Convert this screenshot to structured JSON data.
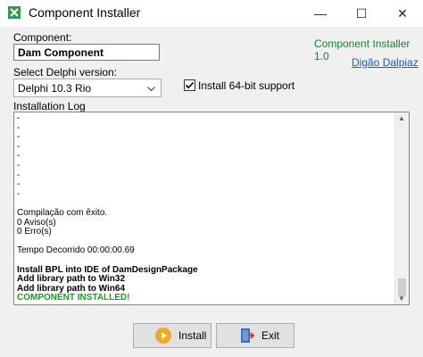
{
  "window": {
    "title": "Component Installer",
    "controls": {
      "minimize": "—",
      "maximize": "☐",
      "close": "✕"
    }
  },
  "header": {
    "component_label": "Component:",
    "component_value": "Dam Component",
    "version_text": "Component Installer 1.0",
    "author_link": "Digão Dalpiaz"
  },
  "delphi": {
    "label": "Select Delphi version:",
    "selected": "Delphi 10.3 Rio",
    "option_64bit_label": "Install 64-bit support",
    "option_64bit_checked": true
  },
  "log": {
    "label": "Installation Log",
    "lines": [
      "-",
      "-",
      "-",
      "-",
      "-",
      "-",
      "-",
      "-",
      "-",
      "",
      "Compilação com êxito.",
      "    0 Aviso(s)",
      "    0 Erro(s)",
      "",
      "Tempo Decorrido 00:00:00.69",
      "",
      "Install BPL into IDE of DamDesignPackage",
      "Add library path to Win32",
      "Add library path to Win64",
      "COMPONENT INSTALLED!"
    ],
    "success_color": "#1aa01a"
  },
  "buttons": {
    "install": "Install",
    "exit": "Exit"
  }
}
